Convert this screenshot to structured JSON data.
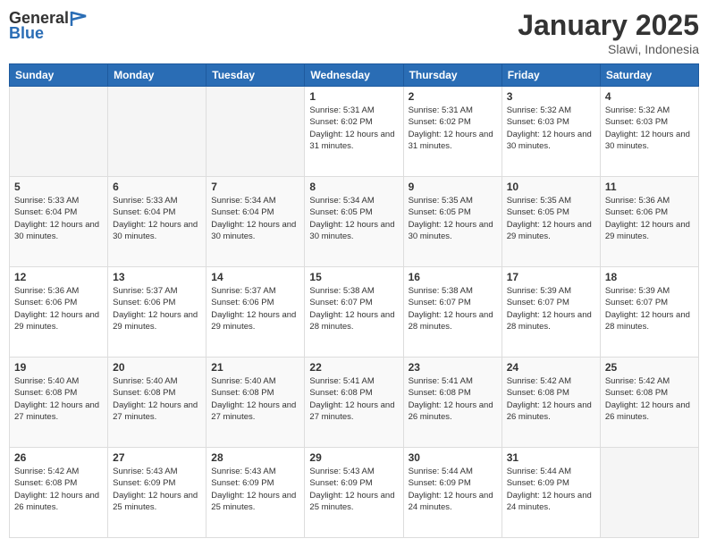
{
  "logo": {
    "general": "General",
    "blue": "Blue"
  },
  "header": {
    "month": "January 2025",
    "location": "Slawi, Indonesia"
  },
  "weekdays": [
    "Sunday",
    "Monday",
    "Tuesday",
    "Wednesday",
    "Thursday",
    "Friday",
    "Saturday"
  ],
  "weeks": [
    [
      {
        "day": "",
        "sunrise": "",
        "sunset": "",
        "daylight": ""
      },
      {
        "day": "",
        "sunrise": "",
        "sunset": "",
        "daylight": ""
      },
      {
        "day": "",
        "sunrise": "",
        "sunset": "",
        "daylight": ""
      },
      {
        "day": "1",
        "sunrise": "Sunrise: 5:31 AM",
        "sunset": "Sunset: 6:02 PM",
        "daylight": "Daylight: 12 hours and 31 minutes."
      },
      {
        "day": "2",
        "sunrise": "Sunrise: 5:31 AM",
        "sunset": "Sunset: 6:02 PM",
        "daylight": "Daylight: 12 hours and 31 minutes."
      },
      {
        "day": "3",
        "sunrise": "Sunrise: 5:32 AM",
        "sunset": "Sunset: 6:03 PM",
        "daylight": "Daylight: 12 hours and 30 minutes."
      },
      {
        "day": "4",
        "sunrise": "Sunrise: 5:32 AM",
        "sunset": "Sunset: 6:03 PM",
        "daylight": "Daylight: 12 hours and 30 minutes."
      }
    ],
    [
      {
        "day": "5",
        "sunrise": "Sunrise: 5:33 AM",
        "sunset": "Sunset: 6:04 PM",
        "daylight": "Daylight: 12 hours and 30 minutes."
      },
      {
        "day": "6",
        "sunrise": "Sunrise: 5:33 AM",
        "sunset": "Sunset: 6:04 PM",
        "daylight": "Daylight: 12 hours and 30 minutes."
      },
      {
        "day": "7",
        "sunrise": "Sunrise: 5:34 AM",
        "sunset": "Sunset: 6:04 PM",
        "daylight": "Daylight: 12 hours and 30 minutes."
      },
      {
        "day": "8",
        "sunrise": "Sunrise: 5:34 AM",
        "sunset": "Sunset: 6:05 PM",
        "daylight": "Daylight: 12 hours and 30 minutes."
      },
      {
        "day": "9",
        "sunrise": "Sunrise: 5:35 AM",
        "sunset": "Sunset: 6:05 PM",
        "daylight": "Daylight: 12 hours and 30 minutes."
      },
      {
        "day": "10",
        "sunrise": "Sunrise: 5:35 AM",
        "sunset": "Sunset: 6:05 PM",
        "daylight": "Daylight: 12 hours and 29 minutes."
      },
      {
        "day": "11",
        "sunrise": "Sunrise: 5:36 AM",
        "sunset": "Sunset: 6:06 PM",
        "daylight": "Daylight: 12 hours and 29 minutes."
      }
    ],
    [
      {
        "day": "12",
        "sunrise": "Sunrise: 5:36 AM",
        "sunset": "Sunset: 6:06 PM",
        "daylight": "Daylight: 12 hours and 29 minutes."
      },
      {
        "day": "13",
        "sunrise": "Sunrise: 5:37 AM",
        "sunset": "Sunset: 6:06 PM",
        "daylight": "Daylight: 12 hours and 29 minutes."
      },
      {
        "day": "14",
        "sunrise": "Sunrise: 5:37 AM",
        "sunset": "Sunset: 6:06 PM",
        "daylight": "Daylight: 12 hours and 29 minutes."
      },
      {
        "day": "15",
        "sunrise": "Sunrise: 5:38 AM",
        "sunset": "Sunset: 6:07 PM",
        "daylight": "Daylight: 12 hours and 28 minutes."
      },
      {
        "day": "16",
        "sunrise": "Sunrise: 5:38 AM",
        "sunset": "Sunset: 6:07 PM",
        "daylight": "Daylight: 12 hours and 28 minutes."
      },
      {
        "day": "17",
        "sunrise": "Sunrise: 5:39 AM",
        "sunset": "Sunset: 6:07 PM",
        "daylight": "Daylight: 12 hours and 28 minutes."
      },
      {
        "day": "18",
        "sunrise": "Sunrise: 5:39 AM",
        "sunset": "Sunset: 6:07 PM",
        "daylight": "Daylight: 12 hours and 28 minutes."
      }
    ],
    [
      {
        "day": "19",
        "sunrise": "Sunrise: 5:40 AM",
        "sunset": "Sunset: 6:08 PM",
        "daylight": "Daylight: 12 hours and 27 minutes."
      },
      {
        "day": "20",
        "sunrise": "Sunrise: 5:40 AM",
        "sunset": "Sunset: 6:08 PM",
        "daylight": "Daylight: 12 hours and 27 minutes."
      },
      {
        "day": "21",
        "sunrise": "Sunrise: 5:40 AM",
        "sunset": "Sunset: 6:08 PM",
        "daylight": "Daylight: 12 hours and 27 minutes."
      },
      {
        "day": "22",
        "sunrise": "Sunrise: 5:41 AM",
        "sunset": "Sunset: 6:08 PM",
        "daylight": "Daylight: 12 hours and 27 minutes."
      },
      {
        "day": "23",
        "sunrise": "Sunrise: 5:41 AM",
        "sunset": "Sunset: 6:08 PM",
        "daylight": "Daylight: 12 hours and 26 minutes."
      },
      {
        "day": "24",
        "sunrise": "Sunrise: 5:42 AM",
        "sunset": "Sunset: 6:08 PM",
        "daylight": "Daylight: 12 hours and 26 minutes."
      },
      {
        "day": "25",
        "sunrise": "Sunrise: 5:42 AM",
        "sunset": "Sunset: 6:08 PM",
        "daylight": "Daylight: 12 hours and 26 minutes."
      }
    ],
    [
      {
        "day": "26",
        "sunrise": "Sunrise: 5:42 AM",
        "sunset": "Sunset: 6:08 PM",
        "daylight": "Daylight: 12 hours and 26 minutes."
      },
      {
        "day": "27",
        "sunrise": "Sunrise: 5:43 AM",
        "sunset": "Sunset: 6:09 PM",
        "daylight": "Daylight: 12 hours and 25 minutes."
      },
      {
        "day": "28",
        "sunrise": "Sunrise: 5:43 AM",
        "sunset": "Sunset: 6:09 PM",
        "daylight": "Daylight: 12 hours and 25 minutes."
      },
      {
        "day": "29",
        "sunrise": "Sunrise: 5:43 AM",
        "sunset": "Sunset: 6:09 PM",
        "daylight": "Daylight: 12 hours and 25 minutes."
      },
      {
        "day": "30",
        "sunrise": "Sunrise: 5:44 AM",
        "sunset": "Sunset: 6:09 PM",
        "daylight": "Daylight: 12 hours and 24 minutes."
      },
      {
        "day": "31",
        "sunrise": "Sunrise: 5:44 AM",
        "sunset": "Sunset: 6:09 PM",
        "daylight": "Daylight: 12 hours and 24 minutes."
      },
      {
        "day": "",
        "sunrise": "",
        "sunset": "",
        "daylight": ""
      }
    ]
  ]
}
